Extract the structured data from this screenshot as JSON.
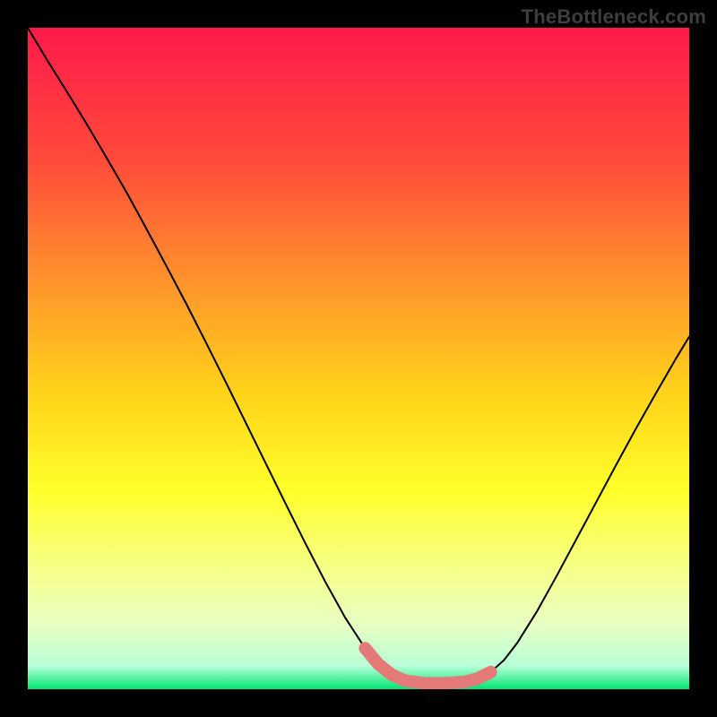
{
  "watermark": "TheBottleneck.com",
  "chart_data": {
    "type": "line",
    "title": "",
    "xlabel": "",
    "ylabel": "",
    "xlim": [
      0,
      100
    ],
    "ylim": [
      0,
      100
    ],
    "gradient_stops": [
      {
        "offset": 0,
        "color": "#ff1a4b"
      },
      {
        "offset": 0.2,
        "color": "#ff4a3a"
      },
      {
        "offset": 0.4,
        "color": "#ff9a2a"
      },
      {
        "offset": 0.55,
        "color": "#ffd21a"
      },
      {
        "offset": 0.7,
        "color": "#ffff2a"
      },
      {
        "offset": 0.82,
        "color": "#f6ff8a"
      },
      {
        "offset": 0.9,
        "color": "#e8ffc0"
      },
      {
        "offset": 0.965,
        "color": "#b8ffd8"
      },
      {
        "offset": 1.0,
        "color": "#00e572"
      }
    ],
    "series": [
      {
        "name": "bottleneck-curve",
        "x": [
          0.0,
          3,
          6,
          9,
          12,
          15,
          18,
          21,
          24,
          27,
          30,
          33,
          36,
          39,
          42,
          45,
          48,
          51,
          53,
          55,
          57,
          60,
          63,
          66,
          68,
          70,
          72,
          74,
          77,
          80,
          83,
          86,
          89,
          92,
          95,
          98,
          100
        ],
        "values": [
          100,
          95,
          90.2,
          85.3,
          80.2,
          75,
          69.5,
          63.9,
          58.2,
          52.3,
          46.3,
          40.2,
          34.1,
          28.0,
          22.0,
          16.2,
          10.8,
          6.2,
          3.8,
          2.2,
          1.3,
          0.9,
          0.9,
          1.1,
          1.6,
          2.6,
          4.4,
          7.0,
          11.8,
          17.2,
          22.8,
          28.4,
          34.0,
          39.5,
          44.8,
          50.0,
          53.3
        ]
      }
    ],
    "highlight_band": {
      "name": "optimal-range",
      "color": "#e47a78",
      "x": [
        51,
        53,
        55,
        57,
        60,
        63,
        66,
        68,
        70
      ],
      "values": [
        6.2,
        3.8,
        2.2,
        1.3,
        0.9,
        0.9,
        1.1,
        1.6,
        2.6
      ]
    }
  }
}
